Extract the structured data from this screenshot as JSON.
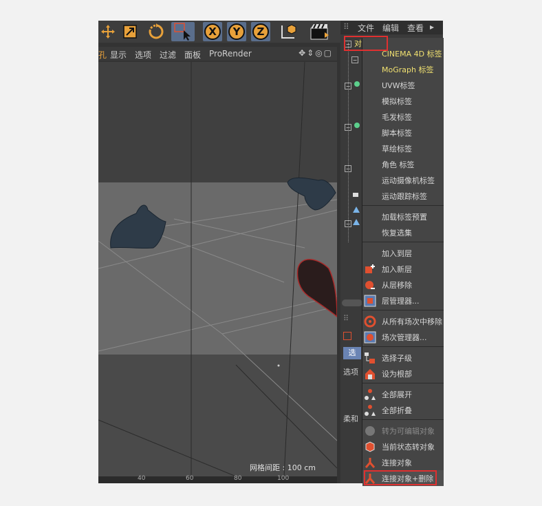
{
  "toolbar": {
    "x_label": "X",
    "y_label": "Y",
    "z_label": "Z"
  },
  "viewport_menu": {
    "items": [
      "显示",
      "选项",
      "过滤",
      "面板",
      "ProRender"
    ],
    "truncated_left": "孔"
  },
  "object_manager": {
    "menu": [
      "文件",
      "编辑",
      "查看"
    ],
    "tab_label": "对象",
    "attr_tab": "选",
    "attr_item1": "选项",
    "attr_item2": "柔和"
  },
  "viewport": {
    "grid_spacing": "网格间距 : 100 cm"
  },
  "ruler": [
    "40",
    "60",
    "80",
    "100"
  ],
  "context_menu": {
    "items": [
      {
        "label": "CINEMA 4D 标签",
        "style": "yellow"
      },
      {
        "label": "MoGraph 标签",
        "style": "yellow"
      },
      {
        "label": "UVW标签"
      },
      {
        "label": "模拟标签"
      },
      {
        "label": "毛发标签"
      },
      {
        "label": "脚本标签"
      },
      {
        "label": "草绘标签"
      },
      {
        "label": "角色 标签"
      },
      {
        "label": "运动摄像机标签"
      },
      {
        "label": "运动跟踪标签"
      },
      {
        "label": "加载标签预置"
      },
      {
        "label": "恢复选集"
      },
      {
        "label": "加入到层"
      },
      {
        "label": "加入新层"
      },
      {
        "label": "从层移除"
      },
      {
        "label": "层管理器..."
      },
      {
        "label": "从所有场次中移除"
      },
      {
        "label": "场次管理器..."
      },
      {
        "label": "选择子级"
      },
      {
        "label": "设为根部"
      },
      {
        "label": "全部展开"
      },
      {
        "label": "全部折叠"
      },
      {
        "label": "转为可编辑对象",
        "style": "disabled"
      },
      {
        "label": "当前状态转对象"
      },
      {
        "label": "连接对象"
      },
      {
        "label": "连接对象+删除"
      }
    ]
  },
  "colors": {
    "accent_orange": "#e8a13a",
    "highlight_red": "#e03030",
    "menu_yellow": "#f0e070"
  }
}
